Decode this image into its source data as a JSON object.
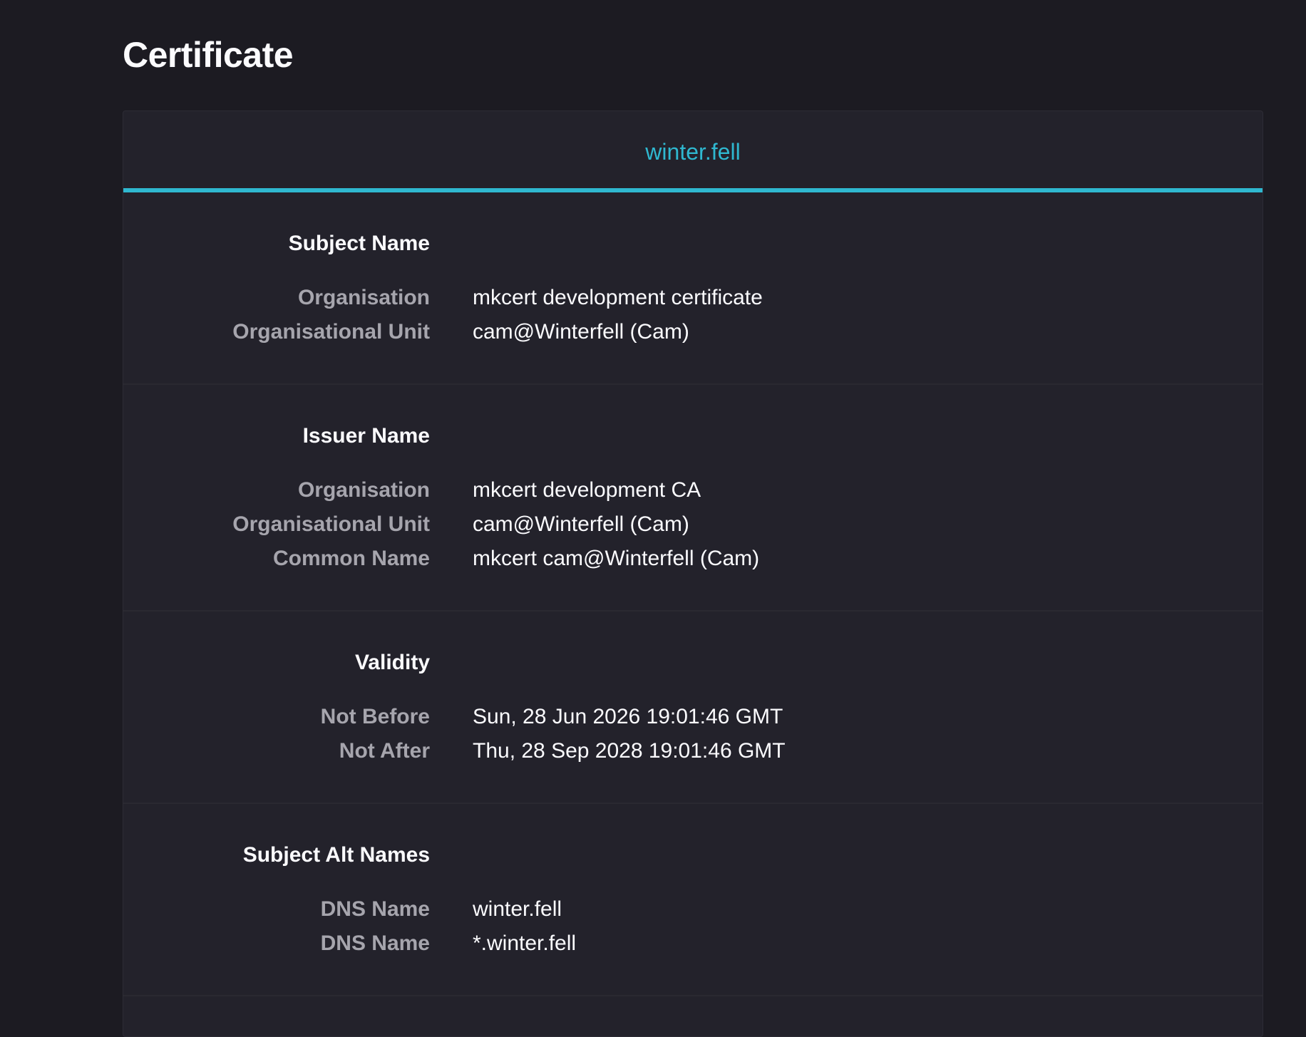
{
  "page": {
    "title": "Certificate"
  },
  "tabs": [
    {
      "label": "winter.fell",
      "selected": true
    }
  ],
  "colors": {
    "accent": "#2fb8d0",
    "background": "#1c1b22",
    "card": "#23222b",
    "label": "#a6a5ad"
  },
  "sections": {
    "subject": {
      "title": "Subject Name",
      "rows": [
        {
          "label": "Organisation",
          "value": "mkcert development certificate"
        },
        {
          "label": "Organisational Unit",
          "value": "cam@Winterfell (Cam)"
        }
      ]
    },
    "issuer": {
      "title": "Issuer Name",
      "rows": [
        {
          "label": "Organisation",
          "value": "mkcert development CA"
        },
        {
          "label": "Organisational Unit",
          "value": "cam@Winterfell (Cam)"
        },
        {
          "label": "Common Name",
          "value": "mkcert cam@Winterfell (Cam)"
        }
      ]
    },
    "validity": {
      "title": "Validity",
      "rows": [
        {
          "label": "Not Before",
          "value": "Sun, 28 Jun 2026 19:01:46 GMT"
        },
        {
          "label": "Not After",
          "value": "Thu, 28 Sep 2028 19:01:46 GMT"
        }
      ]
    },
    "alt_names": {
      "title": "Subject Alt Names",
      "rows": [
        {
          "label": "DNS Name",
          "value": "winter.fell"
        },
        {
          "label": "DNS Name",
          "value": "*.winter.fell"
        }
      ]
    }
  }
}
